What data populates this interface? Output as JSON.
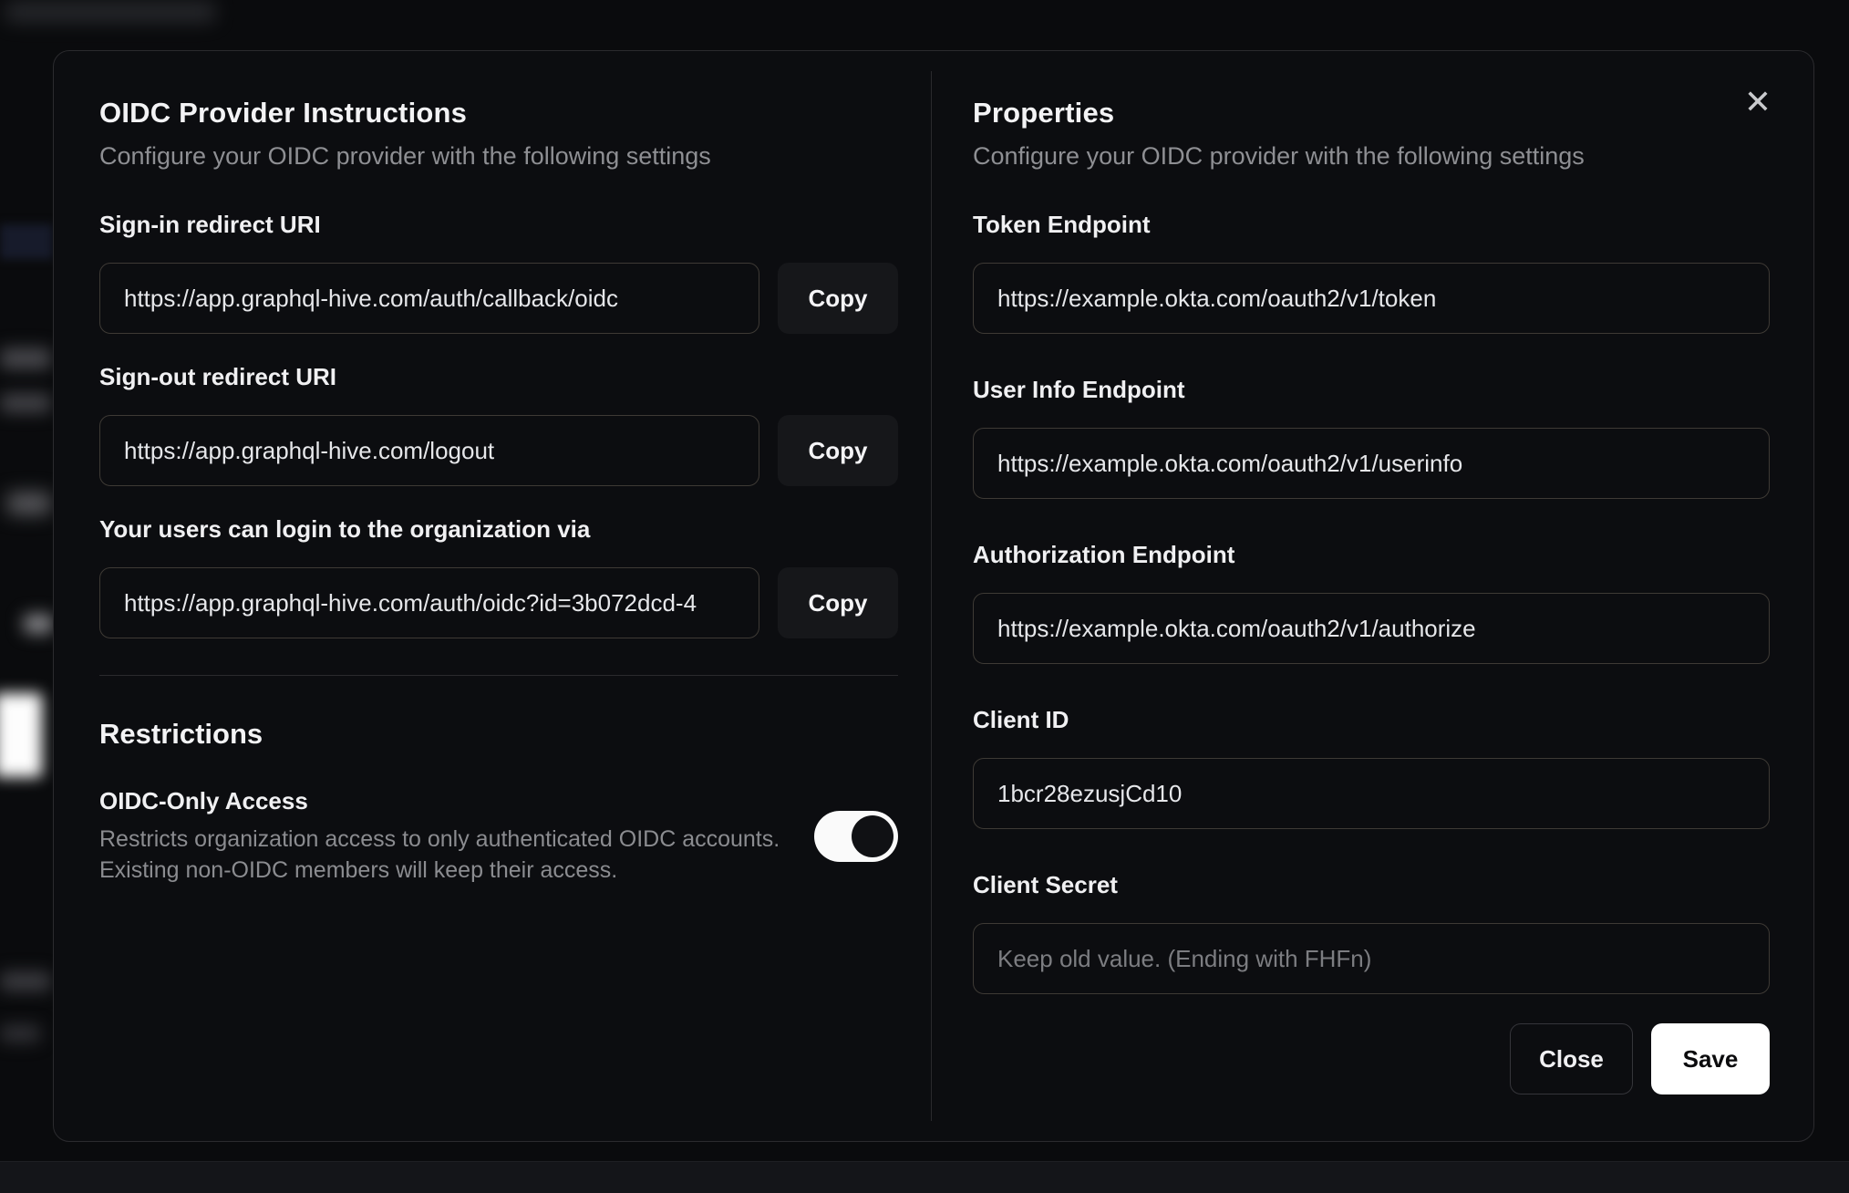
{
  "colors": {
    "modal_bg": "#0c0d10",
    "input_border": "#3e3a35",
    "text_primary": "#f0f0f2",
    "text_secondary": "#8e8f93",
    "save_button_bg": "#ffffff",
    "toggle_track": "#fafafa",
    "toggle_knob": "#101114"
  },
  "icons": {
    "close": "✕"
  },
  "modal": {
    "left": {
      "title": "OIDC Provider Instructions",
      "subtitle": "Configure your OIDC provider with the following settings",
      "fields": [
        {
          "label": "Sign-in redirect URI",
          "value": "https://app.graphql-hive.com/auth/callback/oidc",
          "copy_label": "Copy"
        },
        {
          "label": "Sign-out redirect URI",
          "value": "https://app.graphql-hive.com/logout",
          "copy_label": "Copy"
        },
        {
          "label": "Your users can login to the organization via",
          "value": "https://app.graphql-hive.com/auth/oidc?id=3b072dcd-4",
          "copy_label": "Copy"
        }
      ],
      "restrictions": {
        "title": "Restrictions",
        "toggle_label": "OIDC-Only Access",
        "description_line1": "Restricts organization access to only authenticated OIDC accounts.",
        "description_line2": "Existing non-OIDC members will keep their access.",
        "toggle_state": "on"
      }
    },
    "right": {
      "title": "Properties",
      "subtitle": "Configure your OIDC provider with the following settings",
      "fields": [
        {
          "label": "Token Endpoint",
          "value": "https://example.okta.com/oauth2/v1/token",
          "placeholder": ""
        },
        {
          "label": "User Info Endpoint",
          "value": "https://example.okta.com/oauth2/v1/userinfo",
          "placeholder": ""
        },
        {
          "label": "Authorization Endpoint",
          "value": "https://example.okta.com/oauth2/v1/authorize",
          "placeholder": ""
        },
        {
          "label": "Client ID",
          "value": "1bcr28ezusjCd10",
          "placeholder": ""
        },
        {
          "label": "Client Secret",
          "value": "",
          "placeholder": "Keep old value. (Ending with FHFn)"
        }
      ],
      "buttons": {
        "close": "Close",
        "save": "Save"
      }
    }
  }
}
